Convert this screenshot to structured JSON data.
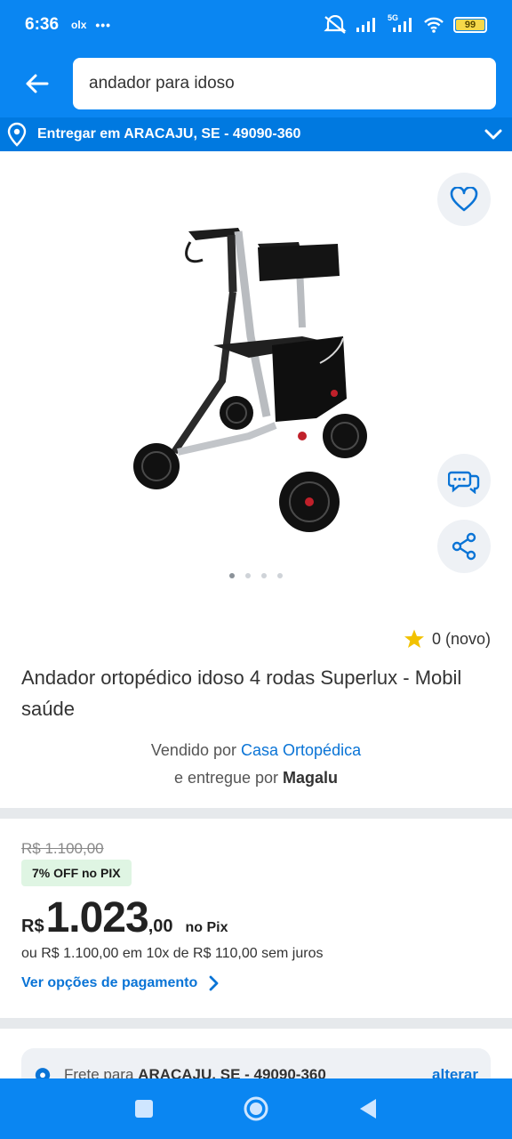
{
  "status_bar": {
    "time": "6:36",
    "notif_app": "olx",
    "more_dots": "•••",
    "network": "5G",
    "battery": "99"
  },
  "search": {
    "query": "andador para idoso"
  },
  "location": {
    "text": "Entregar em ARACAJU, SE - 49090-360"
  },
  "product": {
    "rating_text": "0 (novo)",
    "title": "Andador ortopédico idoso 4 rodas Superlux - Mobil saúde",
    "sold_by_prefix": "Vendido por",
    "seller": "Casa Ortopédica",
    "delivered_by_prefix": "e entregue por",
    "deliverer": "Magalu",
    "image_count": 4,
    "active_image": 1
  },
  "price": {
    "old": "R$ 1.100,00",
    "discount_badge": "7% OFF no PIX",
    "currency": "R$",
    "integer": "1.023",
    "cents": ",00",
    "pix_label": "no Pix",
    "installments": "ou R$ 1.100,00 em 10x de R$ 110,00 sem juros",
    "options_link": "Ver opções de pagamento"
  },
  "shipping": {
    "prefix": "Frete para",
    "location": "ARACAJU, SE - 49090-360",
    "change": "alterar"
  },
  "colors": {
    "primary": "#0a86f2",
    "link": "#0a74d6",
    "discount_bg": "#dff5e3",
    "star": "#f2c200"
  }
}
